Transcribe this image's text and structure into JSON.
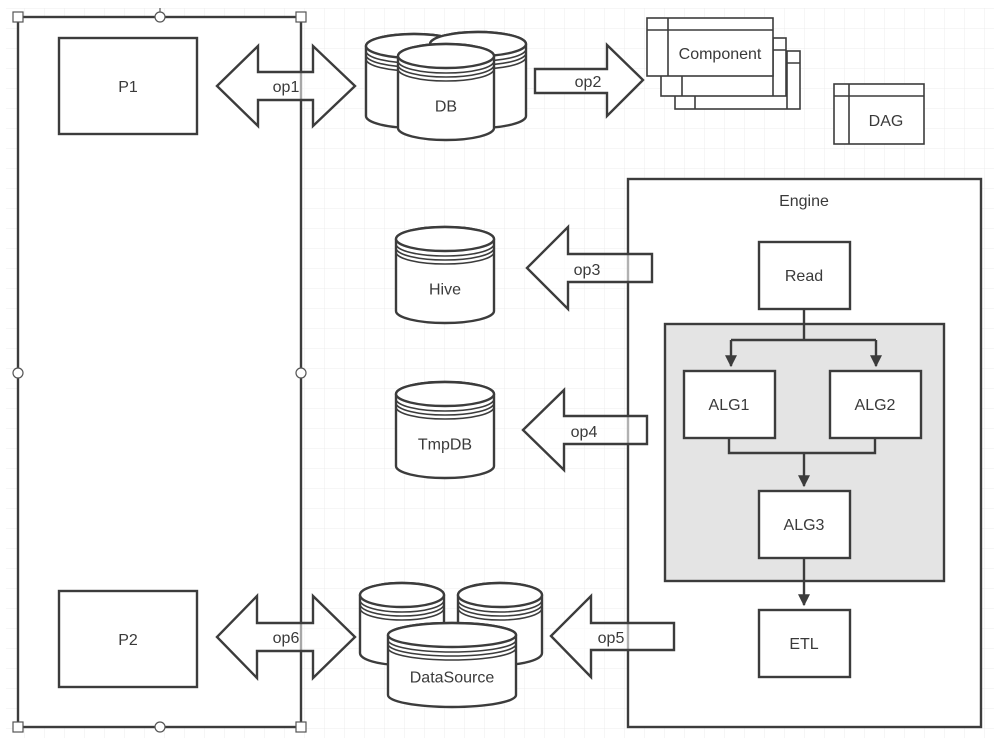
{
  "diagram": {
    "left_panel": {
      "selected": true
    },
    "processes": [
      {
        "id": "p1",
        "label": "P1"
      },
      {
        "id": "p2",
        "label": "P2"
      }
    ],
    "databases": [
      {
        "id": "db",
        "label": "DB",
        "style": "multi"
      },
      {
        "id": "hive",
        "label": "Hive",
        "style": "single"
      },
      {
        "id": "tmpdb",
        "label": "TmpDB",
        "style": "single"
      },
      {
        "id": "datasource",
        "label": "DataSource",
        "style": "multi"
      }
    ],
    "components": [
      {
        "id": "component",
        "label": "Component",
        "style": "stacked"
      },
      {
        "id": "dag",
        "label": "DAG",
        "style": "single"
      }
    ],
    "operations": [
      {
        "id": "op1",
        "label": "op1",
        "direction": "both",
        "from": "P1",
        "to": "DB"
      },
      {
        "id": "op2",
        "label": "op2",
        "direction": "right",
        "from": "DB",
        "to": "Component"
      },
      {
        "id": "op3",
        "label": "op3",
        "direction": "left",
        "from": "Engine",
        "to": "Hive"
      },
      {
        "id": "op4",
        "label": "op4",
        "direction": "left",
        "from": "Engine",
        "to": "TmpDB"
      },
      {
        "id": "op5",
        "label": "op5",
        "direction": "left",
        "from": "Engine",
        "to": "DataSource"
      },
      {
        "id": "op6",
        "label": "op6",
        "direction": "both",
        "from": "P2",
        "to": "DataSource"
      }
    ],
    "engine": {
      "title": "Engine",
      "steps": {
        "read": "Read",
        "alg1": "ALG1",
        "alg2": "ALG2",
        "alg3": "ALG3",
        "etl": "ETL"
      },
      "flow": [
        [
          "Read",
          "ALG1"
        ],
        [
          "Read",
          "ALG2"
        ],
        [
          "ALG1",
          "ALG3"
        ],
        [
          "ALG2",
          "ALG3"
        ],
        [
          "ALG3",
          "ETL"
        ]
      ]
    },
    "colors": {
      "stroke": "#3c3c3c",
      "text": "#3a3a3a",
      "group_fill": "#e4e4e4",
      "grid": "#ececec",
      "background": "#ffffff"
    }
  }
}
